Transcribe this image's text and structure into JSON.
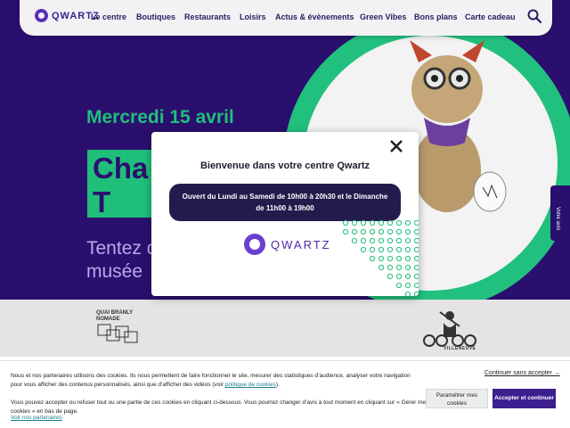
{
  "nav": {
    "logo_text": "QWARTZ",
    "items": [
      "Le centre",
      "Boutiques",
      "Restaurants",
      "Loisirs",
      "Actus & évènements",
      "Green Vibes",
      "Bons plans",
      "Carte cadeau"
    ],
    "search_icon": "search-icon"
  },
  "hero": {
    "date": "Mercredi 15 avril",
    "title": "Cha au T",
    "subtitle": "Tentez d le musée"
  },
  "side_tab": {
    "label": "Votre avis"
  },
  "partners": {
    "quai_branly": "QUAI BRANLY NOMADE",
    "villeneuve": "VILLENEUVE"
  },
  "modal": {
    "title": "Bienvenue dans votre centre Qwartz",
    "hours": "Ouvert du Lundi au Samedi de 10h00 à 20h30 et le Dimanche de 11h00 à 19h00",
    "logo_text": "QWARTZ",
    "close_icon": "close-icon"
  },
  "cookie": {
    "text1_a": "Nous et nos partenaires utilisons des cookies. Ils nous permettent de faire fonctionner le site, mesurer des statistiques d’audience, analyser votre navigation pour vous afficher des contenus personnalisés, ainsi que d’afficher des vidéos (voir ",
    "text1_link": "politique de cookies",
    "text1_b": ").",
    "text2": "Vous pouvez accepter ou refuser tout ou une partie de ces cookies en cliquant ci-dessous. Vous pourrez changer d’avis à tout moment en cliquant sur « Gérer mes cookies » en bas de page.",
    "partners_link": "Voir nos partenaires",
    "continue": "Continuer sans accepter →",
    "params": "Paramétrer mes cookies",
    "accept": "Accepter et continuer"
  },
  "colors": {
    "brand_purple": "#2a0f6e",
    "brand_green": "#1fbf7a",
    "accept_button": "#3b1f8f"
  }
}
